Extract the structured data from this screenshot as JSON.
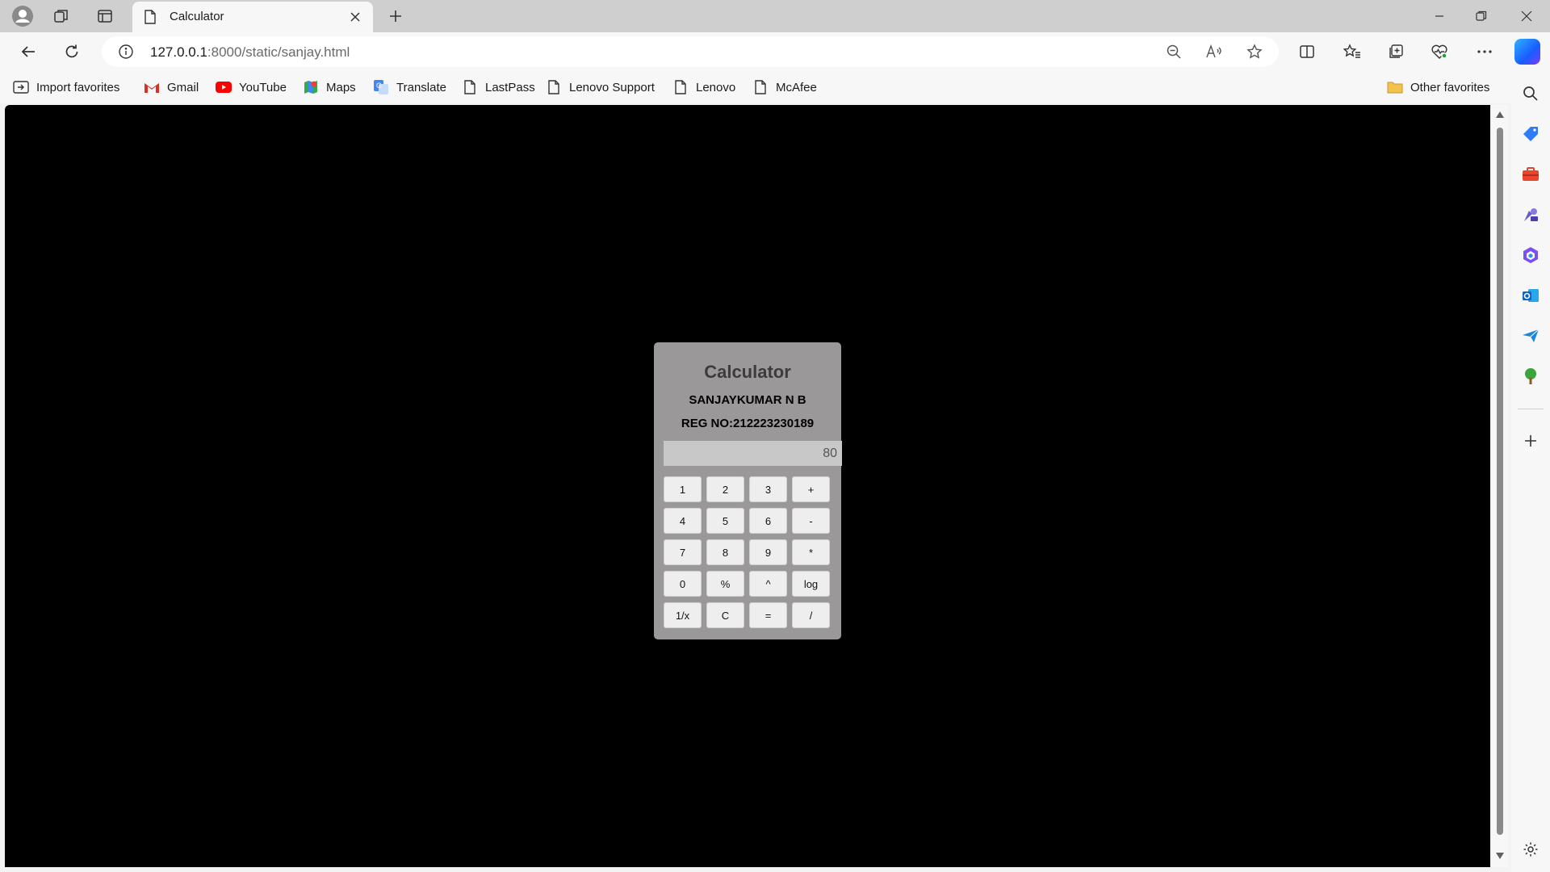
{
  "browser": {
    "tab": {
      "title": "Calculator"
    },
    "address": {
      "host": "127.0.0.1",
      "path": ":8000/static/sanjay.html"
    },
    "favorites": [
      {
        "label": "Import favorites",
        "icon": "import-icon"
      },
      {
        "label": "Gmail",
        "icon": "gmail-icon"
      },
      {
        "label": "YouTube",
        "icon": "youtube-icon"
      },
      {
        "label": "Maps",
        "icon": "maps-icon"
      },
      {
        "label": "Translate",
        "icon": "translate-icon"
      },
      {
        "label": "LastPass",
        "icon": "page-icon"
      },
      {
        "label": "Lenovo Support",
        "icon": "page-icon"
      },
      {
        "label": "Lenovo",
        "icon": "page-icon"
      },
      {
        "label": "McAfee",
        "icon": "page-icon"
      }
    ],
    "other_favorites": "Other favorites"
  },
  "calculator": {
    "title": "Calculator",
    "name": "SANJAYKUMAR N B",
    "reg": "REG NO:212223230189",
    "display_value": "80",
    "keys": [
      "1",
      "2",
      "3",
      "+",
      "4",
      "5",
      "6",
      "-",
      "7",
      "8",
      "9",
      "*",
      "0",
      "%",
      "^",
      "log",
      "1/x",
      "C",
      "=",
      "/"
    ]
  },
  "colors": {
    "page_background": "#000000",
    "calculator_background": "#9a9898",
    "display_background": "#c8c8c8",
    "key_background": "#eeeeee"
  }
}
